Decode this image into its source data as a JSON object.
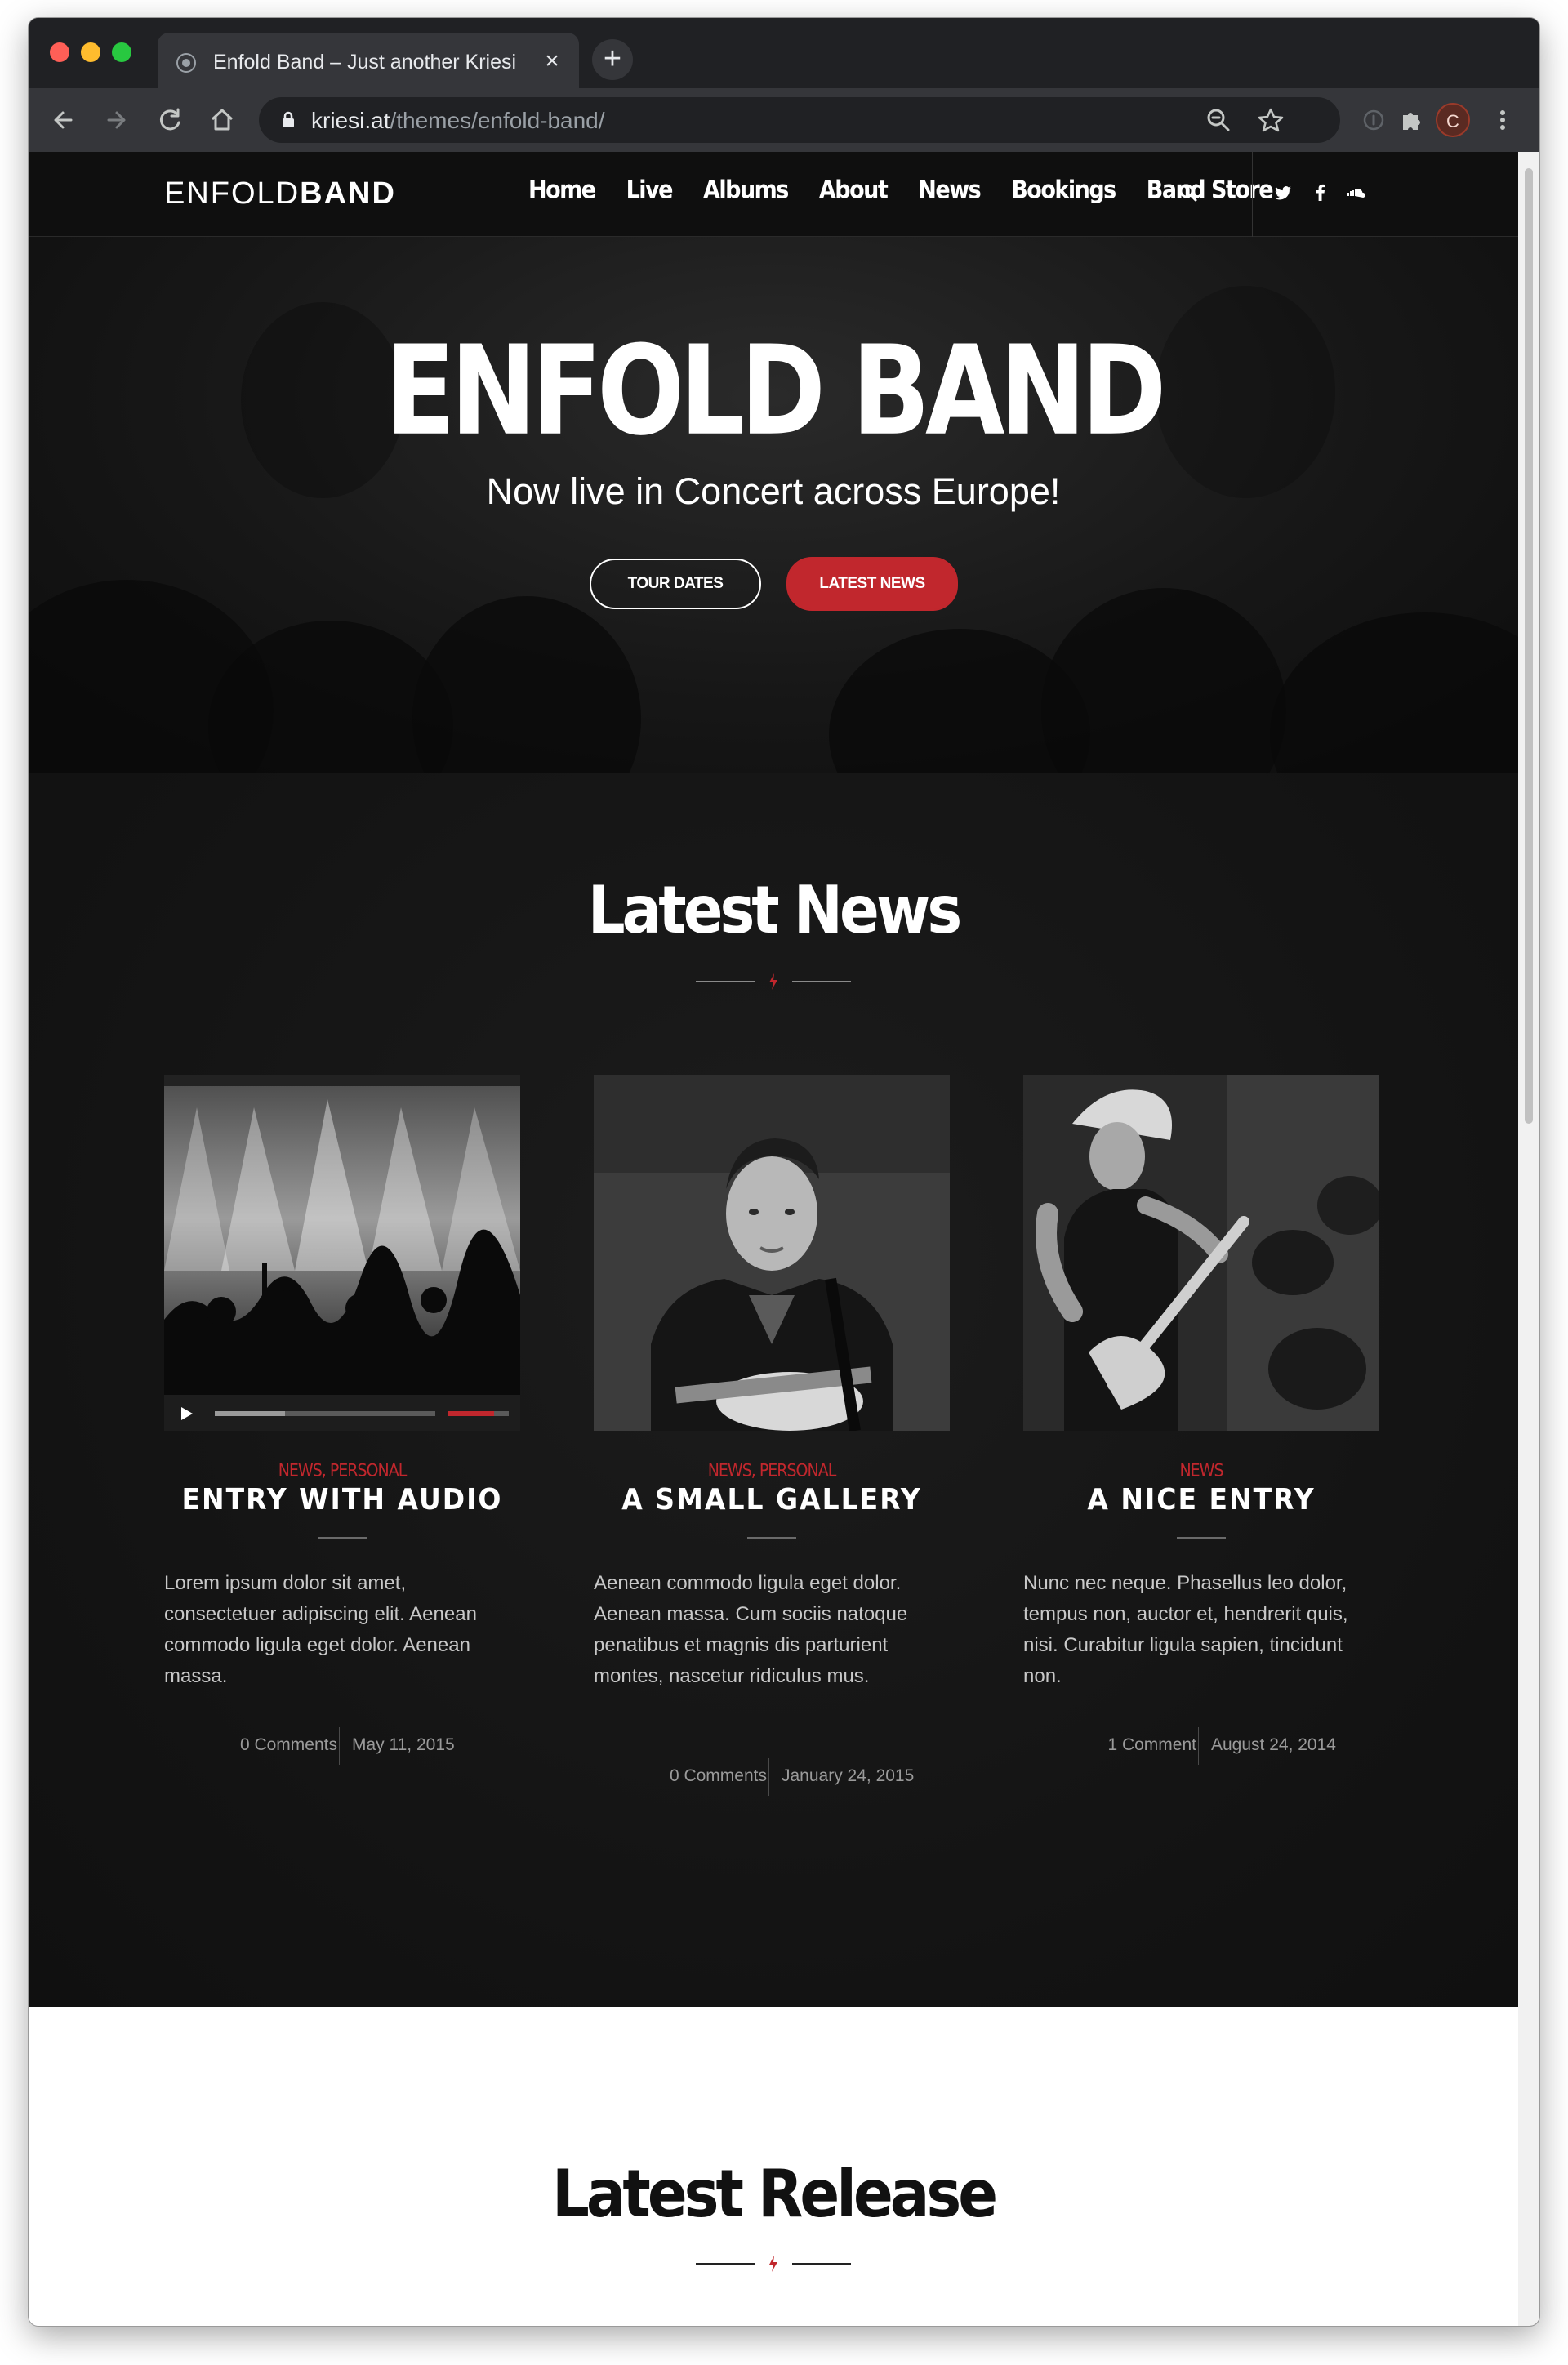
{
  "browser": {
    "tab_title": "Enfold Band – Just another Kriesi",
    "tab_close": "×",
    "new_tab": "+",
    "url_host": "kriesi.at",
    "url_path": "/themes/enfold-band/",
    "profile_initial": "C"
  },
  "site": {
    "logo_light": "ENFOLD",
    "logo_bold": "BAND",
    "nav": [
      "Home",
      "Live",
      "Albums",
      "About",
      "News",
      "Bookings",
      "Band Store"
    ],
    "social": [
      "twitter-icon",
      "facebook-icon",
      "soundcloud-icon"
    ]
  },
  "hero": {
    "title": "ENFOLD BAND",
    "subtitle": "Now live in Concert across Europe!",
    "button_outline": "TOUR DATES",
    "button_primary": "LATEST NEWS"
  },
  "news": {
    "title": "Latest News",
    "posts": [
      {
        "categories": "NEWS, PERSONAL",
        "title": "ENTRY WITH AUDIO",
        "excerpt": "Lorem ipsum dolor sit amet, consectetuer adipiscing elit. Aenean commodo ligula eget dolor. Aenean massa.",
        "comments": "0 Comments",
        "date": "May 11, 2015",
        "audio_progress": 0.32,
        "audio_volume": 0.75
      },
      {
        "categories": "NEWS, PERSONAL",
        "title": "A SMALL GALLERY",
        "excerpt": "Aenean commodo ligula eget dolor. Aenean massa. Cum sociis natoque penatibus et magnis dis parturient montes, nascetur ridiculus mus.",
        "comments": "0 Comments",
        "date": "January 24, 2015"
      },
      {
        "categories": "NEWS",
        "title": "A NICE ENTRY",
        "excerpt": "Nunc nec neque. Phasellus leo dolor, tempus non, auctor et, hendrerit quis, nisi. Curabitur ligula sapien, tincidunt non.",
        "comments": "1 Comment",
        "date": "August 24, 2014"
      }
    ]
  },
  "release": {
    "title": "Latest Release"
  },
  "colors": {
    "accent": "#c1272d",
    "dark_bg": "#151515",
    "header_bg": "#0f0f0f"
  }
}
